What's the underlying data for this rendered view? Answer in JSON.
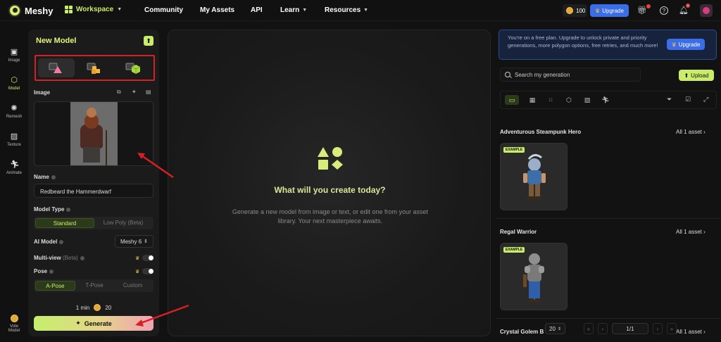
{
  "brand": {
    "name": "Meshy"
  },
  "nav": {
    "workspace": "Workspace",
    "items": [
      "Community",
      "My Assets",
      "API",
      "Learn",
      "Resources"
    ]
  },
  "account": {
    "credits": "100",
    "upgrade_label": "Upgrade",
    "notification_count": "1"
  },
  "sidebar": {
    "items": [
      {
        "label": "Image",
        "icon": "image-icon"
      },
      {
        "label": "Model",
        "icon": "cube-icon"
      },
      {
        "label": "Remesh",
        "icon": "remesh-icon"
      },
      {
        "label": "Texture",
        "icon": "texture-icon"
      },
      {
        "label": "Animate",
        "icon": "running-figure-icon"
      }
    ],
    "vote_label": "Vote Model"
  },
  "panel": {
    "title": "New Model",
    "image_label": "Image",
    "name_label": "Name",
    "name_value": "Redbeard the Hammerdwarf",
    "model_type_label": "Model Type",
    "model_types": [
      "Standard",
      "Low Poly (Beta)"
    ],
    "ai_model_label": "AI Model",
    "ai_model_value": "Meshy 6",
    "multiview_label": "Multi-view",
    "multiview_beta": "(Beta)",
    "pose_label": "Pose",
    "poses": [
      "A-Pose",
      "T-Pose",
      "Custom"
    ],
    "time": "1 min",
    "cost": "20",
    "generate_label": "Generate"
  },
  "center": {
    "heading": "What will you create today?",
    "subtext": "Generate a new model from image or text, or edit one from your asset library. Your next masterpiece awaits."
  },
  "right": {
    "banner_text": "You're on a free plan. Upgrade to unlock private and priority generations, more polygon options, free retries, and much more!",
    "banner_upgrade": "Upgrade",
    "search_placeholder": "Search my generation",
    "upload_label": "Upload",
    "sections": [
      {
        "title": "Adventurous Steampunk Hero",
        "all_label": "All 1 asset",
        "tag": "EXAMPLE"
      },
      {
        "title": "Regal Warrior",
        "all_label": "All 1 asset",
        "tag": "EXAMPLE"
      },
      {
        "title": "Crystal Golem B",
        "all_label": "All 1 asset"
      }
    ],
    "pager": {
      "page_size": "20",
      "page": "1/1"
    }
  },
  "colors": {
    "accent": "#c9ec6a",
    "highlight": "#d71f26",
    "upgrade_blue": "#3b6ee6"
  }
}
